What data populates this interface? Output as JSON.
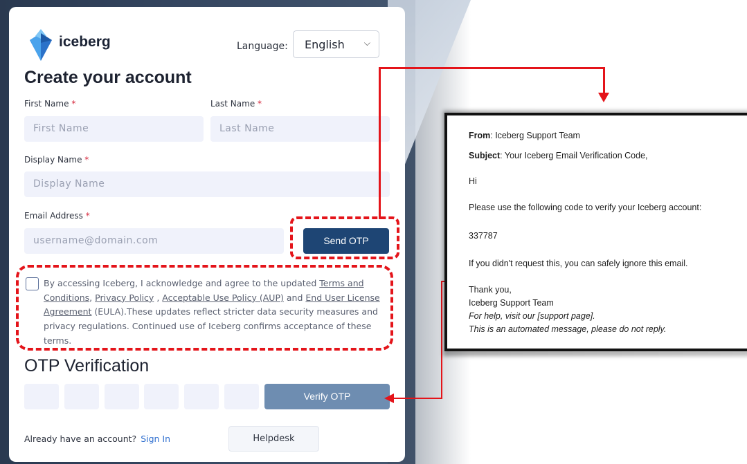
{
  "brand": {
    "name": "iceberg"
  },
  "language": {
    "label": "Language:",
    "selected": "English"
  },
  "form": {
    "title": "Create your account",
    "first_name": {
      "label": "First Name",
      "placeholder": "First Name"
    },
    "last_name": {
      "label": "Last Name",
      "placeholder": "Last Name"
    },
    "display_name": {
      "label": "Display Name",
      "placeholder": "Display Name"
    },
    "email": {
      "label": "Email Address",
      "placeholder": "username@domain.com"
    },
    "required_marker": "*",
    "send_otp": "Send OTP",
    "terms": {
      "prefix": "By accessing Iceberg, I acknowledge and agree to the updated",
      "terms_link": "Terms and Conditions",
      "sep1": ",",
      "privacy_link": "Privacy Policy",
      "sep2": ",",
      "aup_link": "Acceptable Use Policy (AUP)",
      "and": "and",
      "eula_link": "End User License Agreement",
      "suffix": "(EULA).These updates reflect stricter data security measures and privacy regulations. Continued use of Iceberg confirms acceptance of these terms."
    },
    "otp_title": "OTP Verification",
    "verify_otp": "Verify OTP",
    "signin_prompt": "Already have an account?",
    "signin_link": "Sign In",
    "helpdesk": "Helpdesk"
  },
  "email": {
    "from_label": "From",
    "from_value": "Iceberg Support Team",
    "subject_label": "Subject",
    "subject_value": "Your Iceberg Email Verification Code,",
    "greeting": "Hi",
    "instruction": "Please use the following code to verify your Iceberg account:",
    "code": "337787",
    "ignore_note": "If you didn't request this, you can safely ignore this email.",
    "thanks": "Thank you,",
    "signature": "Iceberg Support Team",
    "help_note": "For help, visit our [support page].",
    "auto_note": "This is an automated message, please do not reply."
  },
  "colors": {
    "primary_button": "#1e4574",
    "verify_button": "#6e8db1",
    "highlight": "#e4141a",
    "input_bg": "#f0f2fb"
  }
}
